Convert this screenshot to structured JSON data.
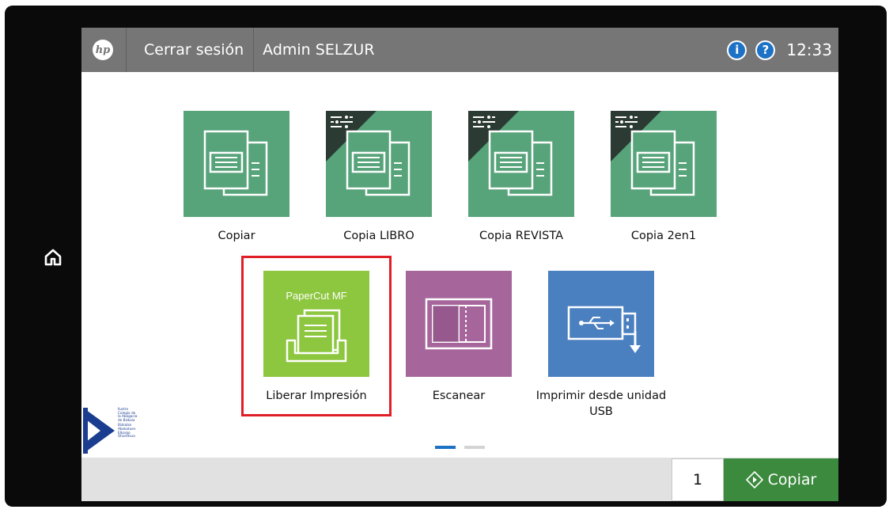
{
  "topbar": {
    "logo": "hp",
    "logout_label": "Cerrar sesión",
    "username": "Admin SELZUR",
    "info_icon": "i",
    "help_icon": "?",
    "time": "12:33"
  },
  "home_icon": "home-icon",
  "apps": [
    {
      "label": "Copiar",
      "icon": "copy-document-icon",
      "color": "#57a37a"
    },
    {
      "label": "Copia LIBRO",
      "icon": "copy-preset-icon",
      "color": "#57a37a"
    },
    {
      "label": "Copia REVISTA",
      "icon": "copy-preset-icon",
      "color": "#57a37a"
    },
    {
      "label": "Copia 2en1",
      "icon": "copy-preset-icon",
      "color": "#57a37a"
    },
    {
      "label": "Liberar Impresión",
      "brand": "PaperCut MF",
      "icon": "print-release-tray-icon",
      "color": "#8dc63f"
    },
    {
      "label": "Escanear",
      "icon": "scan-icon",
      "color": "#a6669c"
    },
    {
      "label_line1": "Imprimir desde unidad",
      "label_line2": "USB",
      "icon": "usb-drive-icon",
      "color": "#4a7fc0"
    }
  ],
  "pagination": {
    "pages": 2,
    "current": 1
  },
  "bottom": {
    "copies_value": "1",
    "start_label": "Copiar"
  },
  "school_logo": {
    "lines_es": [
      "Ilustre",
      "Colegio de",
      "la Abogacía",
      "de Bizkaia"
    ],
    "lines_eu": [
      "Bizkaiko",
      "Abokatuen",
      "Elkargo",
      "Ohoretsua"
    ]
  },
  "colors": {
    "highlight": "#e01e25",
    "topbar": "#767676",
    "start_button": "#3c8a3e",
    "accent_corner": "#f0c419"
  }
}
